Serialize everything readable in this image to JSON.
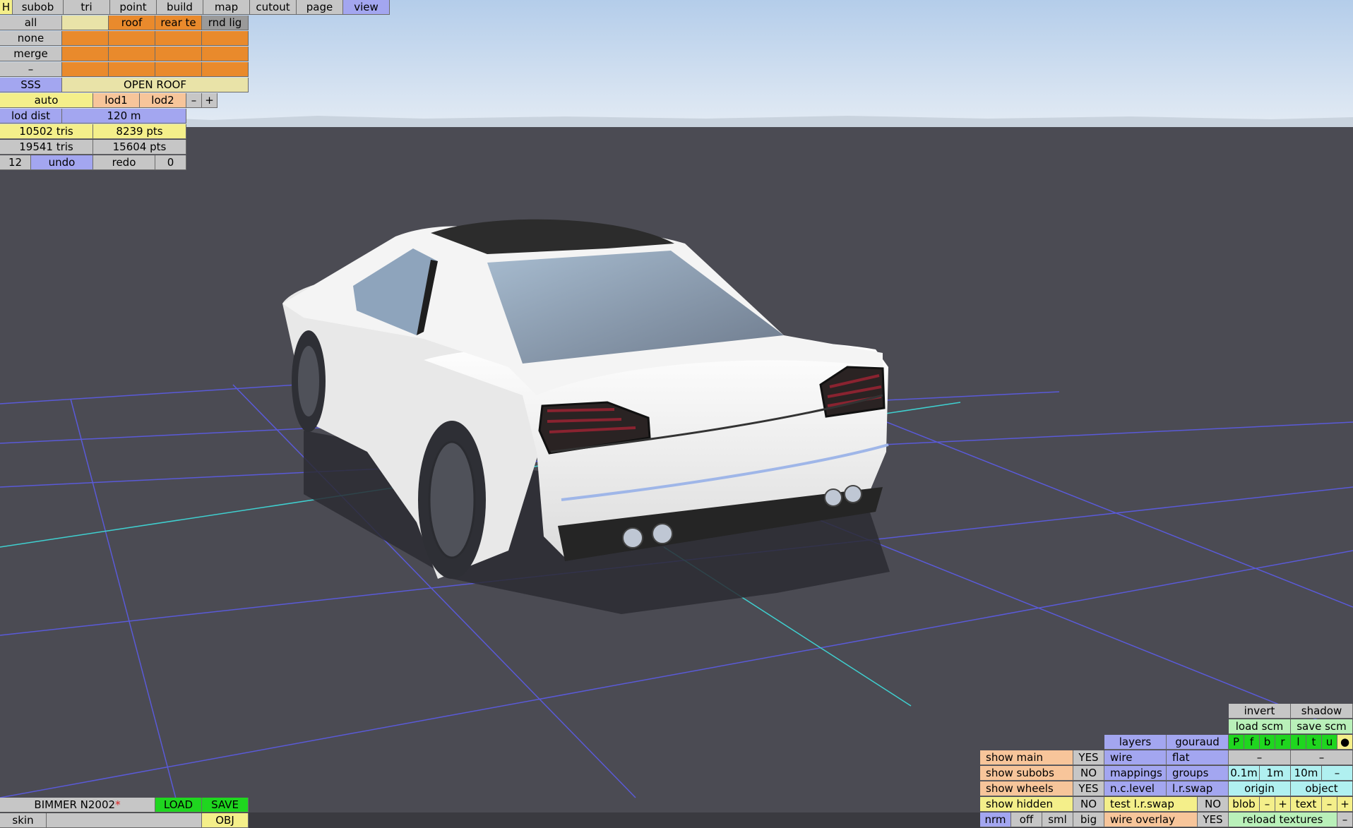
{
  "colors": {
    "sky_top": "#b7d0ec",
    "sky_bottom": "#dfe9f4",
    "ground": "#4b4b53",
    "grid": "#5a5ad8",
    "axis": "#3fd0d0",
    "body_paint": "#f2f2f2"
  },
  "top_menu": {
    "h": "H",
    "tabs": [
      "subob",
      "tri",
      "point",
      "build",
      "map",
      "cutout",
      "page",
      "view"
    ]
  },
  "left_panel": {
    "all": "all",
    "roof": "roof",
    "rear": "rear te",
    "rnd": "rnd lig",
    "none": "none",
    "merge": "merge",
    "dash": "–",
    "sss": "SSS",
    "open_roof": "OPEN ROOF",
    "auto": "auto",
    "lod1": "lod1",
    "lod2": "lod2",
    "minus": "–",
    "plus": "+",
    "lod_dist_label": "lod dist",
    "lod_dist_value": "120 m",
    "tris1": "10502 tris",
    "pts1": "8239 pts",
    "tris2": "19541 tris",
    "pts2": "15604 pts",
    "undo_count": "12",
    "undo": "undo",
    "redo": "redo",
    "redo_count": "0"
  },
  "file_bar": {
    "name": "BIMMER N2002",
    "modified_mark": "*",
    "load": "LOAD",
    "save": "SAVE",
    "skin": "skin",
    "obj": "OBJ"
  },
  "view_panel": {
    "invert": "invert",
    "shadow": "shadow",
    "load_scm": "load scm",
    "save_scm": "save scm",
    "view_letters": [
      "P",
      "f",
      "b",
      "r",
      "l",
      "t",
      "u",
      "●"
    ],
    "dash": "–",
    "layers": "layers",
    "gouraud": "gouraud",
    "wire": "wire",
    "flat": "flat",
    "mappings": "mappings",
    "groups": "groups",
    "step_01": "0.1m",
    "step_1": "1m",
    "step_10": "10m",
    "nc_level": "n.c.level",
    "lr_swap": "l.r.swap",
    "origin": "origin",
    "object": "object",
    "show_main": "show main",
    "show_main_val": "YES",
    "show_subobs": "show subobs",
    "show_subobs_val": "NO",
    "show_wheels": "show wheels",
    "show_wheels_val": "YES",
    "show_hidden": "show hidden",
    "show_hidden_val": "NO",
    "test_lr_swap": "test l.r.swap",
    "test_lr_swap_val": "NO",
    "blob": "blob",
    "text": "text",
    "minus": "–",
    "plus": "+",
    "nrm": "nrm",
    "off": "off",
    "sml": "sml",
    "big": "big",
    "wire_overlay": "wire overlay",
    "wire_overlay_val": "YES",
    "reload_textures": "reload textures"
  }
}
